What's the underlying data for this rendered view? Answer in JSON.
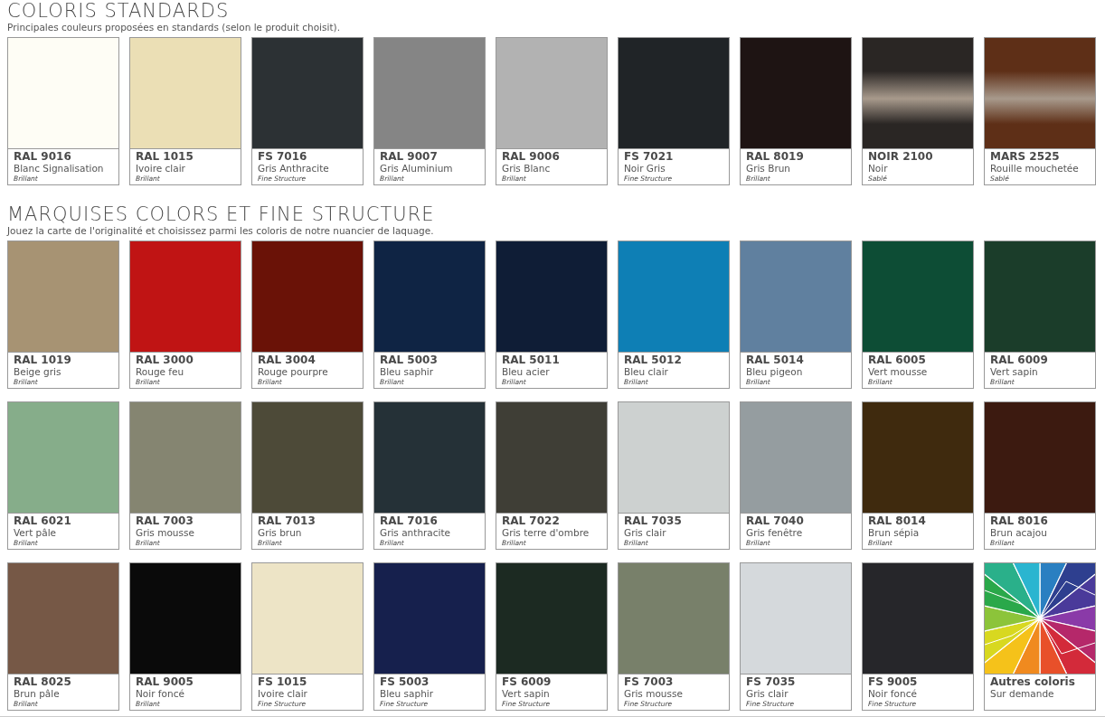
{
  "sections": [
    {
      "title": "COLORIS STANDARDS",
      "subtitle": "Principales couleurs proposées en standards (selon le produit choisit).",
      "swatches": [
        {
          "code": "RAL 9016",
          "name": "Blanc Signalisation",
          "finish": "Brillant",
          "kind": "plain",
          "color": "#fefdf5"
        },
        {
          "code": "RAL 1015",
          "name": "Ivoire clair",
          "finish": "Brillant",
          "kind": "plain",
          "color": "#ebdfb5"
        },
        {
          "code": "FS 7016",
          "name": "Gris Anthracite",
          "finish": "Fine Structure",
          "kind": "plain",
          "color": "#2c3134"
        },
        {
          "code": "RAL 9007",
          "name": "Gris Aluminium",
          "finish": "Brillant",
          "kind": "plain",
          "color": "#858585"
        },
        {
          "code": "RAL 9006",
          "name": "Gris Blanc",
          "finish": "Brillant",
          "kind": "plain",
          "color": "#b2b2b2"
        },
        {
          "code": "FS 7021",
          "name": "Noir Gris",
          "finish": "Fine Structure",
          "kind": "plain",
          "color": "#202427"
        },
        {
          "code": "RAL 8019",
          "name": "Gris Brun",
          "finish": "Brillant",
          "kind": "plain",
          "color": "#1e1413"
        },
        {
          "code": "NOIR 2100",
          "name": "Noir",
          "finish": "Sablé",
          "kind": "metallic",
          "color": "#2a2624"
        },
        {
          "code": "MARS 2525",
          "name": "Rouille mouchetée",
          "finish": "Sablé",
          "kind": "metallic",
          "color": "#5e2f17"
        }
      ]
    },
    {
      "title": "MARQUISES COLORS ET FINE STRUCTURE",
      "subtitle": "Jouez la carte de l'originalité et choisissez parmi les coloris de notre nuancier de laquage.",
      "swatches": [
        {
          "code": "RAL 1019",
          "name": "Beige gris",
          "finish": "Brillant",
          "kind": "plain",
          "color": "#a79373"
        },
        {
          "code": "RAL 3000",
          "name": "Rouge feu",
          "finish": "Brillant",
          "kind": "plain",
          "color": "#c01414"
        },
        {
          "code": "RAL 3004",
          "name": "Rouge pourpre",
          "finish": "Brillant",
          "kind": "plain",
          "color": "#6a1207"
        },
        {
          "code": "RAL 5003",
          "name": "Bleu saphir",
          "finish": "Brillant",
          "kind": "plain",
          "color": "#0f2444"
        },
        {
          "code": "RAL 5011",
          "name": "Bleu acier",
          "finish": "Brillant",
          "kind": "plain",
          "color": "#0f1d36"
        },
        {
          "code": "RAL 5012",
          "name": "Bleu clair",
          "finish": "Brillant",
          "kind": "plain",
          "color": "#0e7fb5"
        },
        {
          "code": "RAL 5014",
          "name": "Bleu pigeon",
          "finish": "Brillant",
          "kind": "plain",
          "color": "#60809f"
        },
        {
          "code": "RAL 6005",
          "name": "Vert mousse",
          "finish": "Brillant",
          "kind": "plain",
          "color": "#0d4d35"
        },
        {
          "code": "RAL 6009",
          "name": "Vert sapin",
          "finish": "Brillant",
          "kind": "plain",
          "color": "#1b3d2a"
        },
        {
          "code": "RAL 6021",
          "name": "Vert pâle",
          "finish": "Brillant",
          "kind": "plain",
          "color": "#86ad8a"
        },
        {
          "code": "RAL 7003",
          "name": "Gris mousse",
          "finish": "Brillant",
          "kind": "plain",
          "color": "#858571"
        },
        {
          "code": "RAL 7013",
          "name": "Gris brun",
          "finish": "Brillant",
          "kind": "plain",
          "color": "#4d4a38"
        },
        {
          "code": "RAL 7016",
          "name": "Gris anthracite",
          "finish": "Brillant",
          "kind": "plain",
          "color": "#253137"
        },
        {
          "code": "RAL 7022",
          "name": "Gris terre d'ombre",
          "finish": "Brillant",
          "kind": "plain",
          "color": "#3f3e36"
        },
        {
          "code": "RAL 7035",
          "name": "Gris clair",
          "finish": "Brillant",
          "kind": "plain",
          "color": "#cdd1d0"
        },
        {
          "code": "RAL 7040",
          "name": "Gris fenêtre",
          "finish": "Brillant",
          "kind": "plain",
          "color": "#959da0"
        },
        {
          "code": "RAL 8014",
          "name": "Brun sépia",
          "finish": "Brillant",
          "kind": "plain",
          "color": "#3f2a0e"
        },
        {
          "code": "RAL 8016",
          "name": "Brun acajou",
          "finish": "Brillant",
          "kind": "plain",
          "color": "#3c1a10"
        },
        {
          "code": "RAL 8025",
          "name": "Brun pâle",
          "finish": "Brillant",
          "kind": "plain",
          "color": "#765846"
        },
        {
          "code": "RAL 9005",
          "name": "Noir foncé",
          "finish": "Brillant",
          "kind": "plain",
          "color": "#0a0a0a"
        },
        {
          "code": "FS 1015",
          "name": "Ivoire clair",
          "finish": "Fine Structure",
          "kind": "plain",
          "color": "#ede4c6"
        },
        {
          "code": "FS 5003",
          "name": "Bleu saphir",
          "finish": "Fine Structure",
          "kind": "plain",
          "color": "#16204d"
        },
        {
          "code": "FS 6009",
          "name": "Vert sapin",
          "finish": "Fine Structure",
          "kind": "plain",
          "color": "#1c2a22"
        },
        {
          "code": "FS 7003",
          "name": "Gris mousse",
          "finish": "Fine Structure",
          "kind": "plain",
          "color": "#78806a"
        },
        {
          "code": "FS 7035",
          "name": "Gris clair",
          "finish": "Fine Structure",
          "kind": "plain",
          "color": "#d5d9dc"
        },
        {
          "code": "FS 9005",
          "name": "Noir foncé",
          "finish": "Fine Structure",
          "kind": "plain",
          "color": "#26262a"
        },
        {
          "code": "Autres coloris",
          "name": "Sur demande",
          "kind": "mosaic"
        }
      ]
    }
  ]
}
